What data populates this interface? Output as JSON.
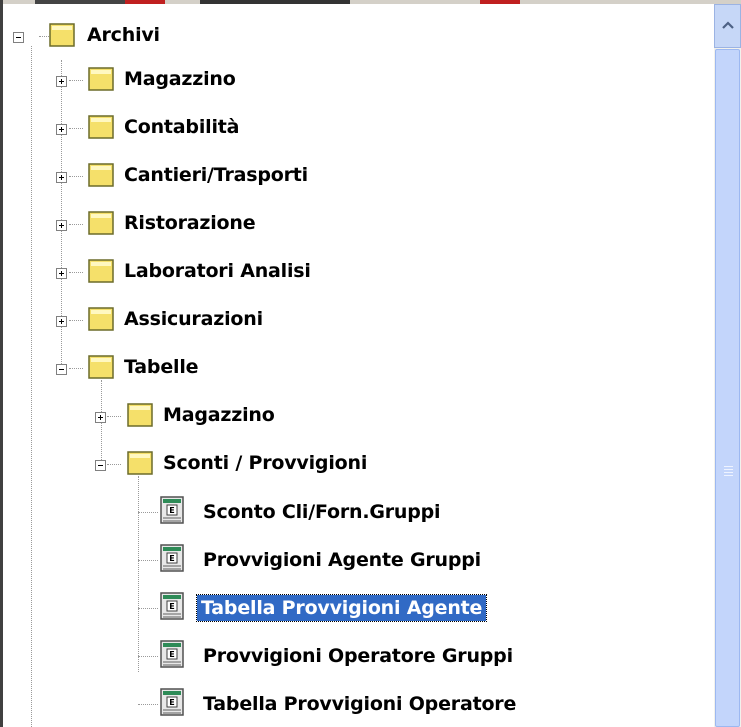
{
  "tree": {
    "root": {
      "label": "Archivi"
    },
    "level1": [
      {
        "label": "Magazzino"
      },
      {
        "label": "Contabilità"
      },
      {
        "label": "Cantieri/Trasporti"
      },
      {
        "label": "Ristorazione"
      },
      {
        "label": "Laboratori Analisi"
      },
      {
        "label": "Assicurazioni"
      },
      {
        "label": "Tabelle"
      }
    ],
    "tabelle_children": [
      {
        "label": "Magazzino"
      },
      {
        "label": "Sconti / Provvigioni"
      }
    ],
    "sconti_children": [
      {
        "label": "Sconto Cli/Forn.Gruppi"
      },
      {
        "label": "Provvigioni Agente Gruppi"
      },
      {
        "label": "Tabella Provvigioni Agente",
        "selected": true
      },
      {
        "label": "Provvigioni Operatore Gruppi"
      },
      {
        "label": "Tabella Provvigioni Operatore"
      }
    ]
  },
  "colors": {
    "selection": "#316ac5",
    "folder": "#f5e06a",
    "scroll_thumb": "#c3d5fb"
  }
}
